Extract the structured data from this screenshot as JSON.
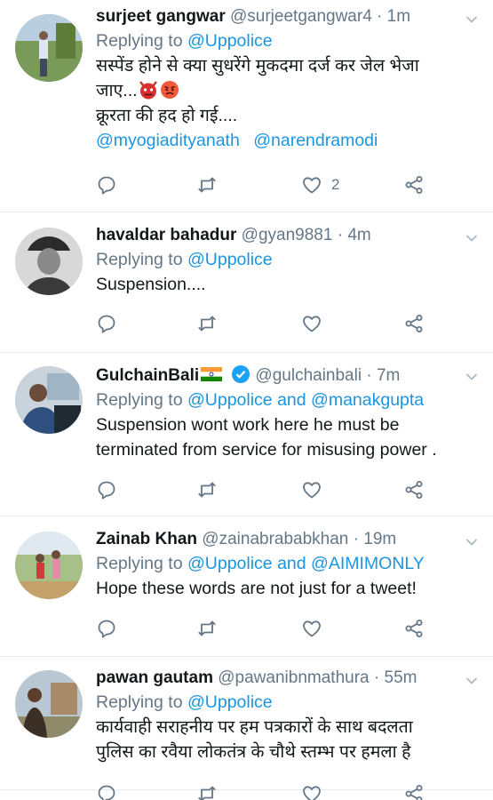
{
  "tweets": [
    {
      "name": "surjeet gangwar",
      "handle": "@surjeetgangwar4",
      "time": "1m",
      "replying_prefix": "Replying to",
      "replying_to": "@Uppolice",
      "text_line1": "सस्पेंड होने से क्या सुधरेंगे मुकदमा दर्ज कर जेल भेजा",
      "text_line2": "जाए...",
      "text_line3": "क्रूरता की हद हो गई....",
      "mentions": [
        "@myogiadityanath",
        "@narendramodi"
      ],
      "emojis": [
        "angry-devil-emoji",
        "angry-face-emoji"
      ],
      "like_count": "2"
    },
    {
      "name": "havaldar bahadur",
      "handle": "@gyan9881",
      "time": "4m",
      "replying_prefix": "Replying to",
      "replying_to": "@Uppolice",
      "text_line1": "Suspension...."
    },
    {
      "name": "GulchainBali",
      "handle": "@gulchainbali",
      "time": "7m",
      "replying_prefix": "Replying to",
      "replying_to": "@Uppolice and @manakgupta",
      "text_line1": "Suspension wont work here he must be",
      "text_line2": "terminated from service for misusing power .",
      "badges": [
        "india-flag-icon",
        "verified-icon"
      ]
    },
    {
      "name": "Zainab Khan",
      "handle": "@zainabrababkhan",
      "time": "19m",
      "replying_prefix": "Replying to",
      "replying_to": "@Uppolice and @AIMIMONLY",
      "text_line1": "Hope these words are not just for a tweet!"
    },
    {
      "name": "pawan gautam",
      "handle": "@pawanibnmathura",
      "time": "55m",
      "replying_prefix": "Replying to",
      "replying_to": "@Uppolice",
      "text_line1": "कार्यवाही सराहनीय पर हम पत्रकारों के साथ बदलता",
      "text_line2": "पुलिस का रवैया लोकतंत्र के चौथे स्तम्भ पर हमला है"
    }
  ],
  "separator": "·",
  "colors": {
    "link": "#1b95e0",
    "muted": "#657786",
    "text": "#14171a",
    "divider": "#e6ecf0"
  }
}
